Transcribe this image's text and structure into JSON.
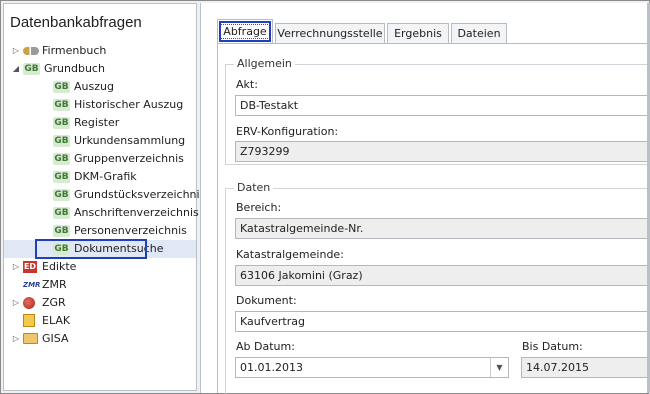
{
  "left_panel": {
    "title": "Datenbankabfragen",
    "tree": [
      {
        "label": "Firmenbuch",
        "level": 0,
        "arrow": "▷",
        "icon": "key-chain-icon"
      },
      {
        "label": "Grundbuch",
        "level": 0,
        "arrow": "◢",
        "icon": "gb-icon"
      },
      {
        "label": "Auszug",
        "level": 1,
        "icon": "gb-icon"
      },
      {
        "label": "Historischer Auszug",
        "level": 1,
        "icon": "gb-icon"
      },
      {
        "label": "Register",
        "level": 1,
        "icon": "gb-icon"
      },
      {
        "label": "Urkundensammlung",
        "level": 1,
        "icon": "gb-icon"
      },
      {
        "label": "Gruppenverzeichnis",
        "level": 1,
        "icon": "gb-icon"
      },
      {
        "label": "DKM-Grafik",
        "level": 1,
        "icon": "gb-icon"
      },
      {
        "label": "Grundstücksverzeichnis",
        "level": 1,
        "icon": "gb-icon"
      },
      {
        "label": "Anschriftenverzeichnis",
        "level": 1,
        "icon": "gb-icon"
      },
      {
        "label": "Personenverzeichnis",
        "level": 1,
        "icon": "gb-icon"
      },
      {
        "label": "Dokumentsuche",
        "level": 1,
        "icon": "gb-icon",
        "selected": true
      },
      {
        "label": "Edikte",
        "level": 0,
        "arrow": "▷",
        "icon": "edikte-icon"
      },
      {
        "label": "ZMR",
        "level": 0,
        "icon": "zmr-icon"
      },
      {
        "label": "ZGR",
        "level": 0,
        "arrow": "▷",
        "icon": "zgr-icon"
      },
      {
        "label": "ELAK",
        "level": 0,
        "icon": "elak-icon"
      },
      {
        "label": "GISA",
        "level": 0,
        "arrow": "▷",
        "icon": "folder-icon"
      }
    ],
    "gb_text": "GB",
    "ed_text": "ED",
    "zmr_text": "ZMR"
  },
  "tabs": [
    "Abfrage",
    "Verrechnungsstelle",
    "Ergebnis",
    "Dateien"
  ],
  "allgemein": {
    "legend": "Allgemein",
    "akt_label": "Akt:",
    "akt_value": "DB-Testakt",
    "erv_label": "ERV-Konfiguration:",
    "erv_value": "Z793299"
  },
  "daten": {
    "legend": "Daten",
    "bereich_label": "Bereich:",
    "bereich_value": "Katastralgemeinde-Nr.",
    "kg_label": "Katastralgemeinde:",
    "kg_value": "63106 Jakomini (Graz)",
    "dokument_label": "Dokument:",
    "dokument_value": "Kaufvertrag",
    "ab_label": "Ab Datum:",
    "ab_value": "01.01.2013",
    "bis_label": "Bis Datum:",
    "bis_value": "14.07.2015"
  },
  "colors": {
    "highlight": "#1f3fbf",
    "gb_green": "#3d7a34"
  }
}
